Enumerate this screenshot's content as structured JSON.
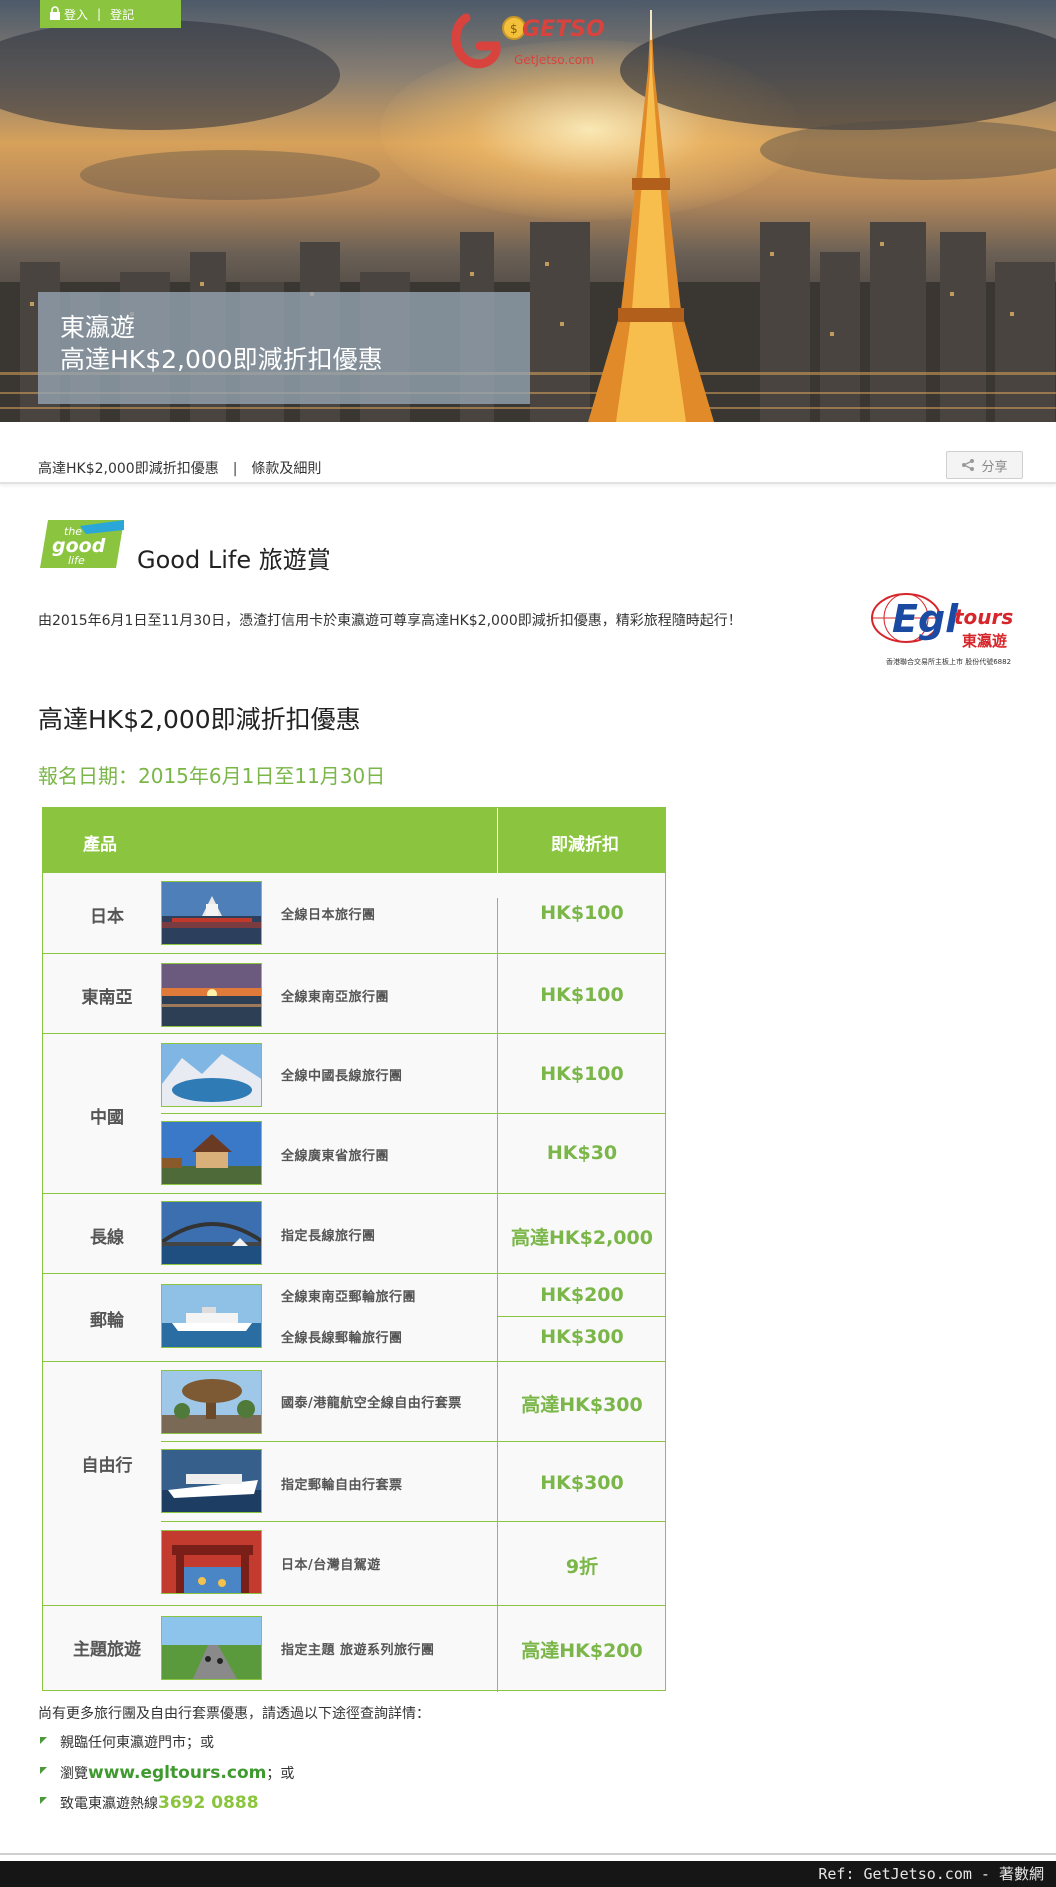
{
  "auth": {
    "login": "登入",
    "separator": "|",
    "register": "登記"
  },
  "watermark": {
    "brand": "GETSO",
    "site": "GetJetso.com"
  },
  "hero": {
    "line1": "東瀛遊",
    "line2": "高達HK$2,000即減折扣優惠"
  },
  "subnav": {
    "link1": "高達HK$2,000即減折扣優惠",
    "separator": "|",
    "link2": "條款及細則",
    "share": "分享"
  },
  "goodlife": {
    "logo_line1": "the",
    "logo_line2": "good",
    "logo_line3": "life",
    "title_en": "Good Life",
    "title_zh": "旅遊賞"
  },
  "intro": "由2015年6月1日至11月30日，憑渣打信用卡於東瀛遊可尊享高達HK$2,000即減折扣優惠，精彩旅程隨時起行！",
  "egl": {
    "brand": "Egl",
    "tours": "tours",
    "zh": "東瀛遊",
    "note": "香港聯合交易所主板上市 股份代號6882"
  },
  "offer_title": "高達HK$2,000即減折扣優惠",
  "period": "報名日期：2015年6月1日至11月30日",
  "table": {
    "header_product": "產品",
    "header_discount": "即減折扣",
    "regions": [
      "日本",
      "東南亞",
      "中國",
      "長線",
      "郵輪",
      "自由行",
      "主題旅遊"
    ],
    "rows": [
      {
        "product": "全線日本旅行團",
        "discount": "HK$100"
      },
      {
        "product": "全線東南亞旅行團",
        "discount": "HK$100"
      },
      {
        "product": "全線中國長線旅行團",
        "discount": "HK$100"
      },
      {
        "product": "全線廣東省旅行團",
        "discount": "HK$30"
      },
      {
        "product": "指定長線旅行團",
        "discount": "高達HK$2,000"
      },
      {
        "product": "全線東南亞郵輪旅行團",
        "discount": "HK$200"
      },
      {
        "product": "全線長線郵輪旅行團",
        "discount": "HK$300"
      },
      {
        "product": "國泰/港龍航空全線自由行套票",
        "discount": "高達HK$300"
      },
      {
        "product": "指定郵輪自由行套票",
        "discount": "HK$300"
      },
      {
        "product": "日本/台灣自駕遊",
        "discount": "9折"
      },
      {
        "product": "指定主題 旅遊系列旅行團",
        "discount": "高達HK$200"
      }
    ]
  },
  "more": "尚有更多旅行團及自由行套票優惠，請透過以下途徑查詢詳情：",
  "contact": {
    "b1": "親臨任何東瀛遊門市；或",
    "b2_pre": "瀏覽",
    "b2_link": "www.egltours.com",
    "b2_post": "；或",
    "b3_pre": "致電東瀛遊熱線",
    "b3_phone": "3692 0888"
  },
  "ref": "Ref: GetJetso.com - 著數網",
  "colors": {
    "green": "#8bc53f",
    "text_green": "#7ab648",
    "link_green": "#3f9a2f",
    "egl_red": "#d7262b"
  }
}
